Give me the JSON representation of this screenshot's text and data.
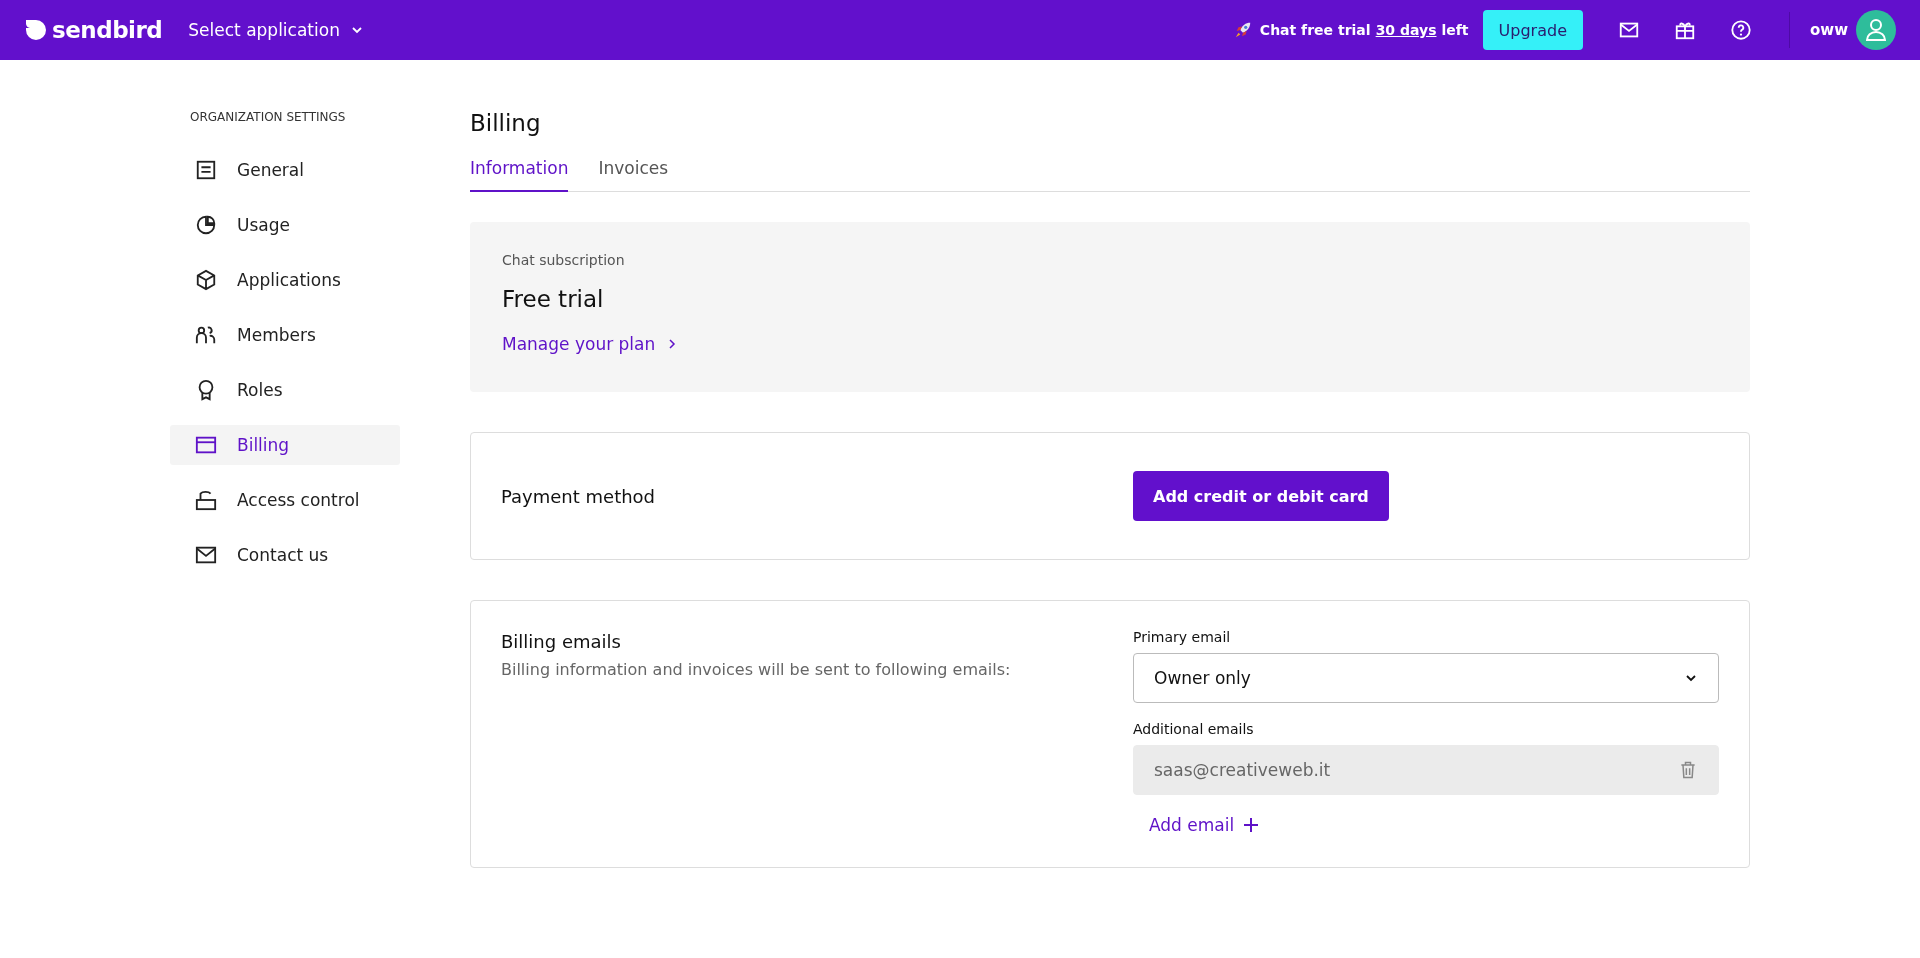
{
  "topbar": {
    "logo": "sendbird",
    "app_selector": "Select application",
    "trial": {
      "prefix": "Chat free trial",
      "link": "30 days",
      "suffix": "left"
    },
    "upgrade": "Upgrade",
    "user": "oww"
  },
  "sidebar": {
    "heading": "ORGANIZATION SETTINGS",
    "items": [
      {
        "label": "General",
        "selected": false
      },
      {
        "label": "Usage",
        "selected": false
      },
      {
        "label": "Applications",
        "selected": false
      },
      {
        "label": "Members",
        "selected": false
      },
      {
        "label": "Roles",
        "selected": false
      },
      {
        "label": "Billing",
        "selected": true
      },
      {
        "label": "Access control",
        "selected": false
      },
      {
        "label": "Contact us",
        "selected": false
      }
    ]
  },
  "page": {
    "title": "Billing",
    "tabs": [
      {
        "label": "Information",
        "selected": true
      },
      {
        "label": "Invoices",
        "selected": false
      }
    ]
  },
  "subscription": {
    "label": "Chat subscription",
    "plan": "Free trial",
    "link": "Manage your plan"
  },
  "payment": {
    "title": "Payment method",
    "button": "Add credit or debit card"
  },
  "billing_emails": {
    "title": "Billing emails",
    "description": "Billing information and invoices will be sent to following emails:",
    "primary_label": "Primary email",
    "primary_value": "Owner only",
    "additional_label": "Additional emails",
    "emails": [
      {
        "value": "saas@creativeweb.it",
        "disabled": true
      }
    ],
    "add_email": "Add email"
  }
}
